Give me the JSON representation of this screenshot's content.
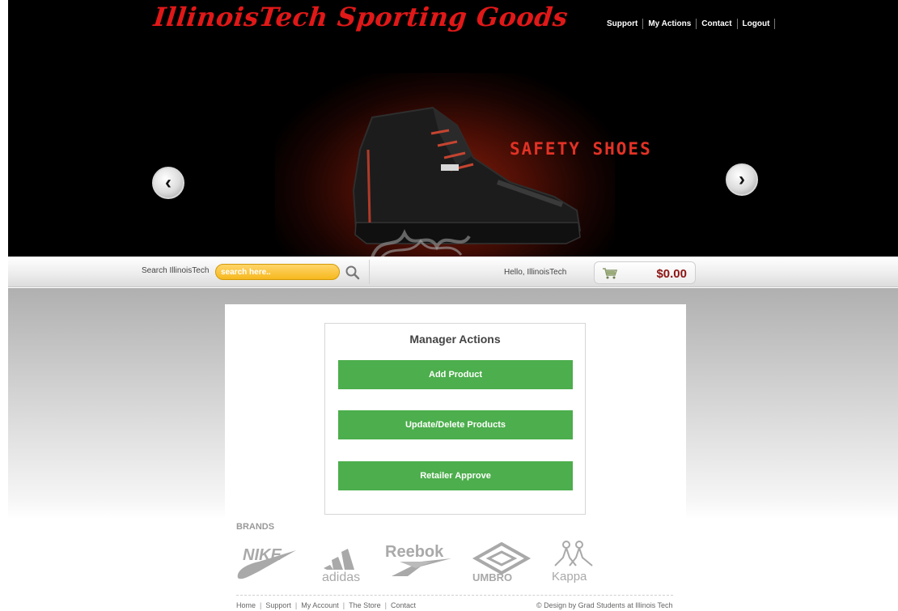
{
  "header": {
    "logo_text": "IllinoisTech Sporting Goods",
    "nav": [
      "Support",
      "My Actions",
      "Contact",
      "Logout"
    ]
  },
  "hero": {
    "caption": "SAFETY SHOES",
    "prev_icon": "chevron-left-icon",
    "next_icon": "chevron-right-icon"
  },
  "search": {
    "label": "Search IllinoisTech",
    "placeholder": "search here..",
    "button_icon": "search-icon"
  },
  "user": {
    "greeting": "Hello, IllinoisTech"
  },
  "cart": {
    "icon": "cart-icon",
    "total": "$0.00"
  },
  "manager_actions": {
    "title": "Manager Actions",
    "buttons": [
      "Add Product",
      "Update/Delete Products",
      "Retailer Approve"
    ]
  },
  "brands": {
    "title": "BRANDS",
    "items": [
      "NIKE",
      "adidas",
      "Reebok",
      "UMBRO",
      "Kappa"
    ]
  },
  "footer": {
    "links": [
      "Home",
      "Support",
      "My Account",
      "The Store",
      "Contact"
    ],
    "copyright": "© Design by Grad Students at Illinois Tech"
  },
  "colors": {
    "logo_red": "#e01818",
    "action_green": "#4cae4c",
    "cart_total": "#8e1414",
    "search_yellow": "#f6b81e"
  }
}
